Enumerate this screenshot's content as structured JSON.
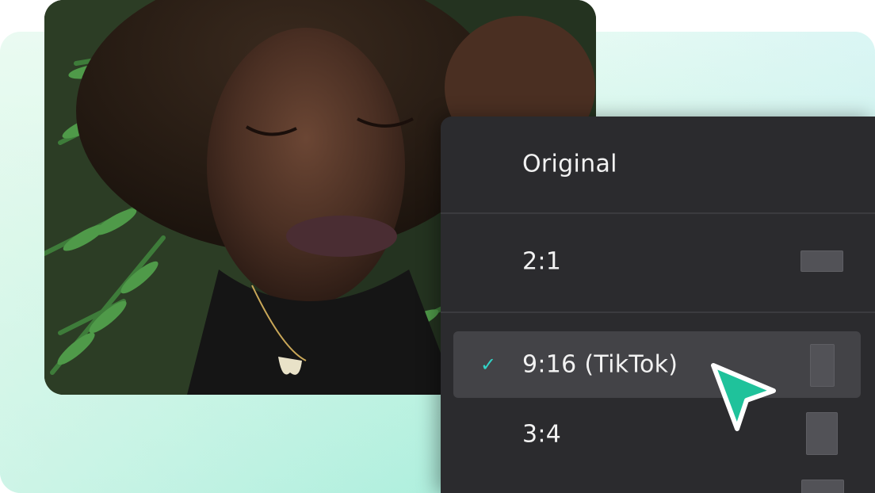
{
  "menu": {
    "items": [
      {
        "label": "Original",
        "selected": false
      },
      {
        "label": "2:1",
        "selected": false
      },
      {
        "label": "9:16 (TikTok)",
        "selected": true
      },
      {
        "label": "3:4",
        "selected": false
      }
    ],
    "check_icon": "check-icon",
    "accent_color": "#32d3c6"
  },
  "cursor": {
    "icon": "pointer-cursor-icon",
    "color": "#1fc29b"
  },
  "photo": {
    "subject": "woman-lying-on-ferns"
  }
}
